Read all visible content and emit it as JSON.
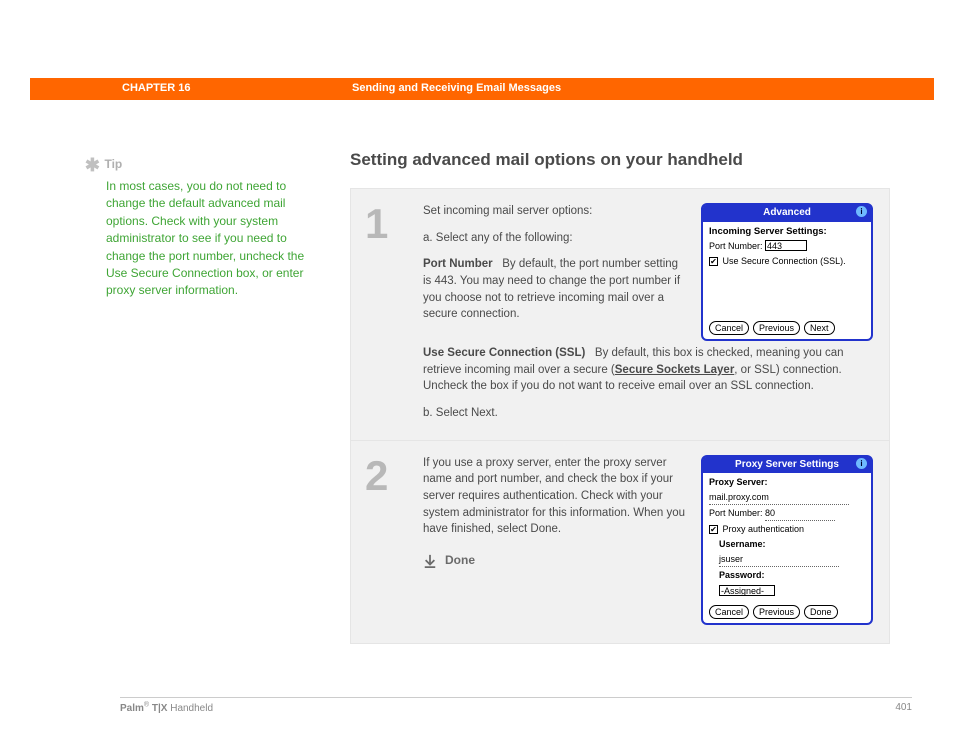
{
  "header": {
    "chapter": "CHAPTER 16",
    "title": "Sending and Receiving Email Messages"
  },
  "sidebar": {
    "tip_label": "Tip",
    "tip_body": "In most cases, you do not need to change the default advanced mail options. Check with your system administrator to see if you need to change the port number, uncheck the Use Secure Connection box, or enter proxy server information."
  },
  "main": {
    "heading": "Setting advanced mail options on your handheld"
  },
  "step1": {
    "num": "1",
    "intro": "Set incoming mail server options:",
    "a": "a.  Select any of the following:",
    "port_label": "Port Number",
    "port_body": "By default, the port number setting is 443. You may need to change the port number if you choose not to retrieve incoming mail over a secure connection.",
    "ssl_label": "Use Secure Connection (SSL)",
    "ssl_pre": "By default, this box is checked, meaning you can retrieve incoming mail over a secure (",
    "ssl_link": "Secure Sockets Layer",
    "ssl_post": ", or SSL) connection. Uncheck the box if you do not want to receive email over an SSL connection.",
    "b": "b.  Select Next.",
    "device": {
      "title": "Advanced",
      "heading": "Incoming Server Settings:",
      "port_label": "Port Number:",
      "port_value": "443",
      "ssl_label": "Use Secure Connection (SSL).",
      "btn_cancel": "Cancel",
      "btn_prev": "Previous",
      "btn_next": "Next"
    }
  },
  "step2": {
    "num": "2",
    "body": "If you use a proxy server, enter the proxy server name and port number, and check the box if your server requires authentication. Check with your system administrator for this information. When you have finished, select Done.",
    "done": "Done",
    "device": {
      "title": "Proxy Server Settings",
      "proxy_label": "Proxy Server:",
      "proxy_value": "mail.proxy.com",
      "port_label": "Port Number:",
      "port_value": "80",
      "auth_label": "Proxy authentication",
      "user_label": "Username:",
      "user_value": "jsuser",
      "pass_label": "Password:",
      "pass_value": "-Assigned-",
      "btn_cancel": "Cancel",
      "btn_prev": "Previous",
      "btn_done": "Done"
    }
  },
  "footer": {
    "brand": "Palm",
    "model": " T|X",
    "suffix": " Handheld",
    "page": "401"
  }
}
